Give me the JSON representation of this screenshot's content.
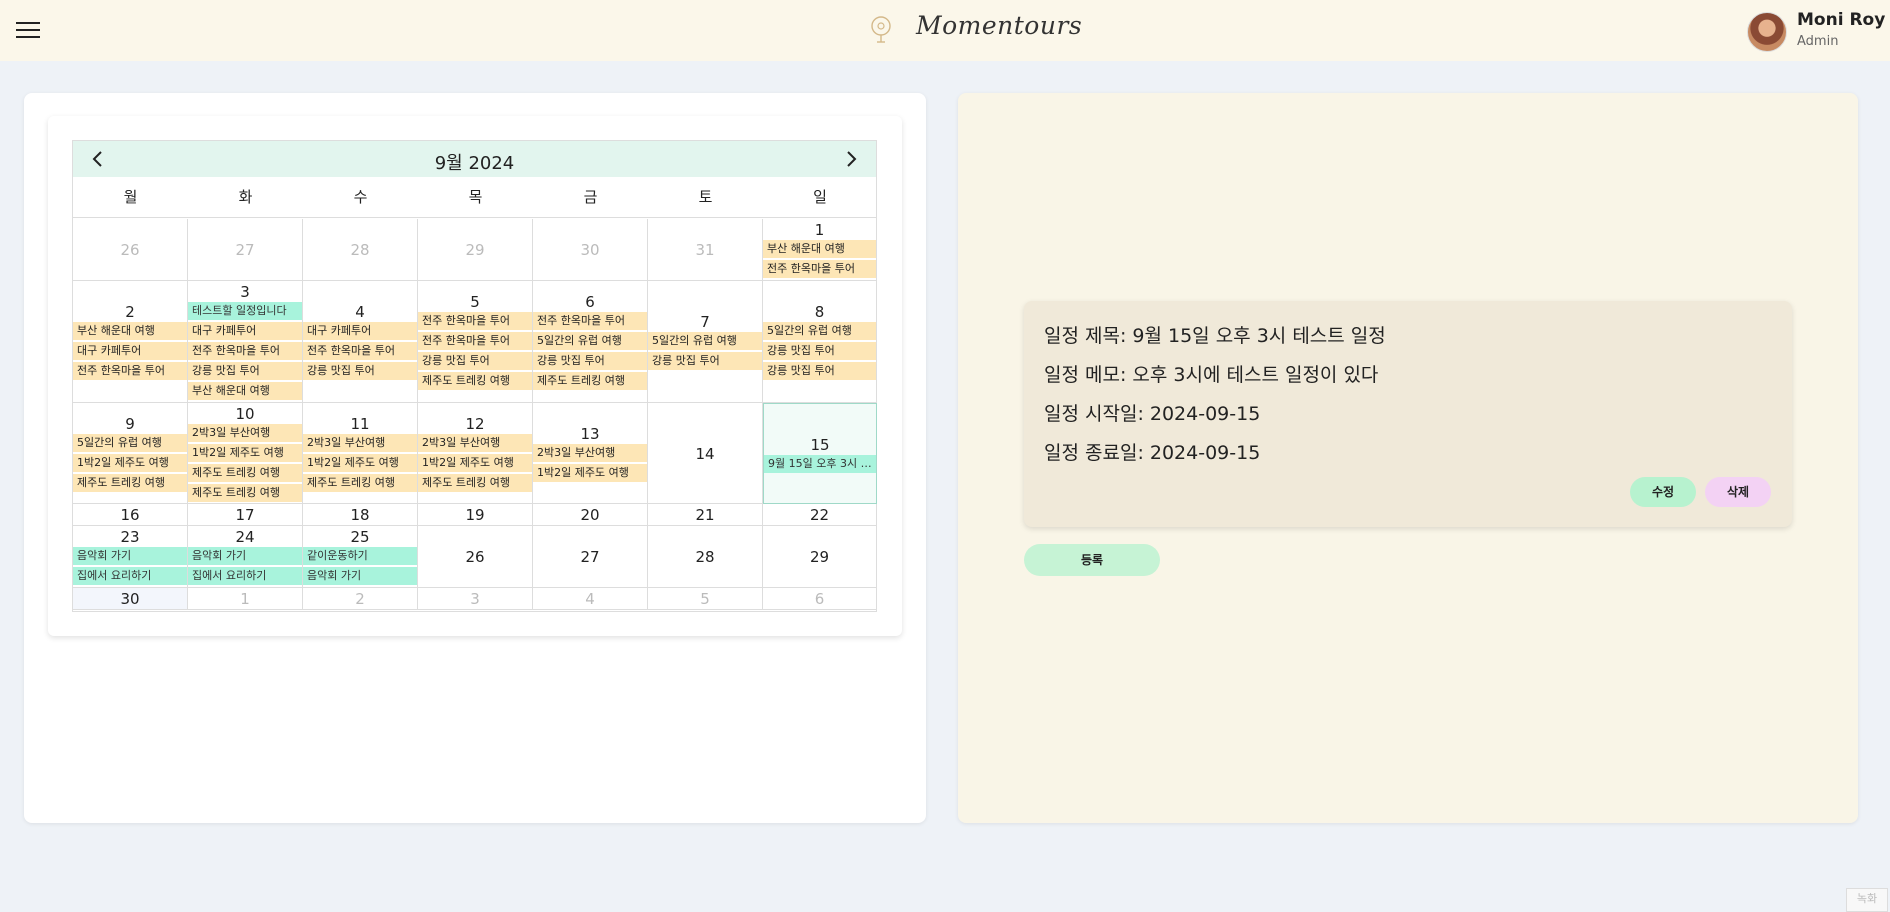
{
  "header": {
    "logo_text": "Momentours",
    "user_name": "Moni Roy",
    "user_role": "Admin"
  },
  "calendar": {
    "title": "9월 2024",
    "weekdays": [
      "월",
      "화",
      "수",
      "목",
      "금",
      "토",
      "일"
    ],
    "weeks": [
      {
        "days": [
          {
            "n": "26",
            "muted": true,
            "events": []
          },
          {
            "n": "27",
            "muted": true,
            "events": []
          },
          {
            "n": "28",
            "muted": true,
            "events": []
          },
          {
            "n": "29",
            "muted": true,
            "events": []
          },
          {
            "n": "30",
            "muted": true,
            "events": []
          },
          {
            "n": "31",
            "muted": true,
            "events": []
          },
          {
            "n": "1",
            "events": [
              {
                "t": "부산 해운대 여행",
                "c": "tan"
              },
              {
                "t": "전주 한옥마을 투어",
                "c": "tan"
              }
            ]
          }
        ]
      },
      {
        "days": [
          {
            "n": "2",
            "events": [
              {
                "t": "부산 해운대 여행",
                "c": "tan"
              },
              {
                "t": "대구 카페투어",
                "c": "tan"
              },
              {
                "t": "전주 한옥마을 투어",
                "c": "tan"
              }
            ]
          },
          {
            "n": "3",
            "events": [
              {
                "t": "테스트할 일정입니다",
                "c": "mint"
              },
              {
                "t": "대구 카페투어",
                "c": "tan"
              },
              {
                "t": "전주 한옥마을 투어",
                "c": "tan"
              },
              {
                "t": "강릉 맛집 투어",
                "c": "tan"
              },
              {
                "t": "부산 해운대 여행",
                "c": "tan"
              }
            ]
          },
          {
            "n": "4",
            "events": [
              {
                "t": "대구 카페투어",
                "c": "tan"
              },
              {
                "t": "전주 한옥마을 투어",
                "c": "tan"
              },
              {
                "t": "강릉 맛집 투어",
                "c": "tan"
              }
            ]
          },
          {
            "n": "5",
            "events": [
              {
                "t": "전주 한옥마을 투어",
                "c": "tan"
              },
              {
                "t": "전주 한옥마을 투어",
                "c": "tan"
              },
              {
                "t": "강릉 맛집 투어",
                "c": "tan"
              },
              {
                "t": "제주도 트레킹 여행",
                "c": "tan"
              }
            ]
          },
          {
            "n": "6",
            "events": [
              {
                "t": "전주 한옥마을 투어",
                "c": "tan"
              },
              {
                "t": "5일간의 유럽 여행",
                "c": "tan"
              },
              {
                "t": "강릉 맛집 투어",
                "c": "tan"
              },
              {
                "t": "제주도 트레킹 여행",
                "c": "tan"
              }
            ]
          },
          {
            "n": "7",
            "events": [
              {
                "t": "5일간의 유럽 여행",
                "c": "tan"
              },
              {
                "t": "강릉 맛집 투어",
                "c": "tan"
              }
            ]
          },
          {
            "n": "8",
            "events": [
              {
                "t": "5일간의 유럽 여행",
                "c": "tan"
              },
              {
                "t": "강릉 맛집 투어",
                "c": "tan"
              },
              {
                "t": "강릉 맛집 투어",
                "c": "tan"
              }
            ]
          }
        ]
      },
      {
        "days": [
          {
            "n": "9",
            "events": [
              {
                "t": "5일간의 유럽 여행",
                "c": "tan"
              },
              {
                "t": "1박2일 제주도 여행",
                "c": "tan"
              },
              {
                "t": "제주도 트레킹 여행",
                "c": "tan"
              }
            ]
          },
          {
            "n": "10",
            "events": [
              {
                "t": "2박3일 부산여행",
                "c": "tan"
              },
              {
                "t": "1박2일 제주도 여행",
                "c": "tan"
              },
              {
                "t": "제주도 트레킹 여행",
                "c": "tan"
              },
              {
                "t": "제주도 트레킹 여행",
                "c": "tan"
              }
            ]
          },
          {
            "n": "11",
            "events": [
              {
                "t": "2박3일 부산여행",
                "c": "tan"
              },
              {
                "t": "1박2일 제주도 여행",
                "c": "tan"
              },
              {
                "t": "제주도 트레킹 여행",
                "c": "tan"
              }
            ]
          },
          {
            "n": "12",
            "events": [
              {
                "t": "2박3일 부산여행",
                "c": "tan"
              },
              {
                "t": "1박2일 제주도 여행",
                "c": "tan"
              },
              {
                "t": "제주도 트레킹 여행",
                "c": "tan"
              }
            ]
          },
          {
            "n": "13",
            "events": [
              {
                "t": "2박3일 부산여행",
                "c": "tan"
              },
              {
                "t": "1박2일 제주도 여행",
                "c": "tan"
              }
            ]
          },
          {
            "n": "14",
            "events": []
          },
          {
            "n": "15",
            "selected": true,
            "events": [
              {
                "t": "9월 15일 오후 3시 테스트 일정",
                "c": "mint"
              }
            ]
          }
        ]
      },
      {
        "days": [
          {
            "n": "16",
            "events": []
          },
          {
            "n": "17",
            "events": []
          },
          {
            "n": "18",
            "events": []
          },
          {
            "n": "19",
            "events": []
          },
          {
            "n": "20",
            "events": []
          },
          {
            "n": "21",
            "events": []
          },
          {
            "n": "22",
            "events": []
          }
        ]
      },
      {
        "days": [
          {
            "n": "23",
            "events": [
              {
                "t": "음악회 가기",
                "c": "mint"
              },
              {
                "t": "집에서 요리하기",
                "c": "mint"
              }
            ]
          },
          {
            "n": "24",
            "events": [
              {
                "t": "음악회 가기",
                "c": "mint"
              },
              {
                "t": "집에서 요리하기",
                "c": "mint"
              }
            ]
          },
          {
            "n": "25",
            "events": [
              {
                "t": "같이운동하기",
                "c": "mint"
              },
              {
                "t": "음악회 가기",
                "c": "mint"
              }
            ]
          },
          {
            "n": "26",
            "events": []
          },
          {
            "n": "27",
            "events": []
          },
          {
            "n": "28",
            "events": []
          },
          {
            "n": "29",
            "events": []
          }
        ]
      },
      {
        "days": [
          {
            "n": "30",
            "today": true,
            "events": []
          },
          {
            "n": "1",
            "muted": true,
            "events": []
          },
          {
            "n": "2",
            "muted": true,
            "events": []
          },
          {
            "n": "3",
            "muted": true,
            "events": []
          },
          {
            "n": "4",
            "muted": true,
            "events": []
          },
          {
            "n": "5",
            "muted": true,
            "events": []
          },
          {
            "n": "6",
            "muted": true,
            "events": []
          }
        ]
      }
    ]
  },
  "detail": {
    "title_line": "일정 제목: 9월 15일 오후 3시 테스트 일정",
    "memo_line": "일정 메모: 오후 3시에 테스트 일정이 있다",
    "start_line": "일정 시작일: 2024-09-15",
    "end_line": "일정 종료일: 2024-09-15",
    "edit_label": "수정",
    "delete_label": "삭제"
  },
  "register_label": "등록",
  "corner_chip": "녹화"
}
